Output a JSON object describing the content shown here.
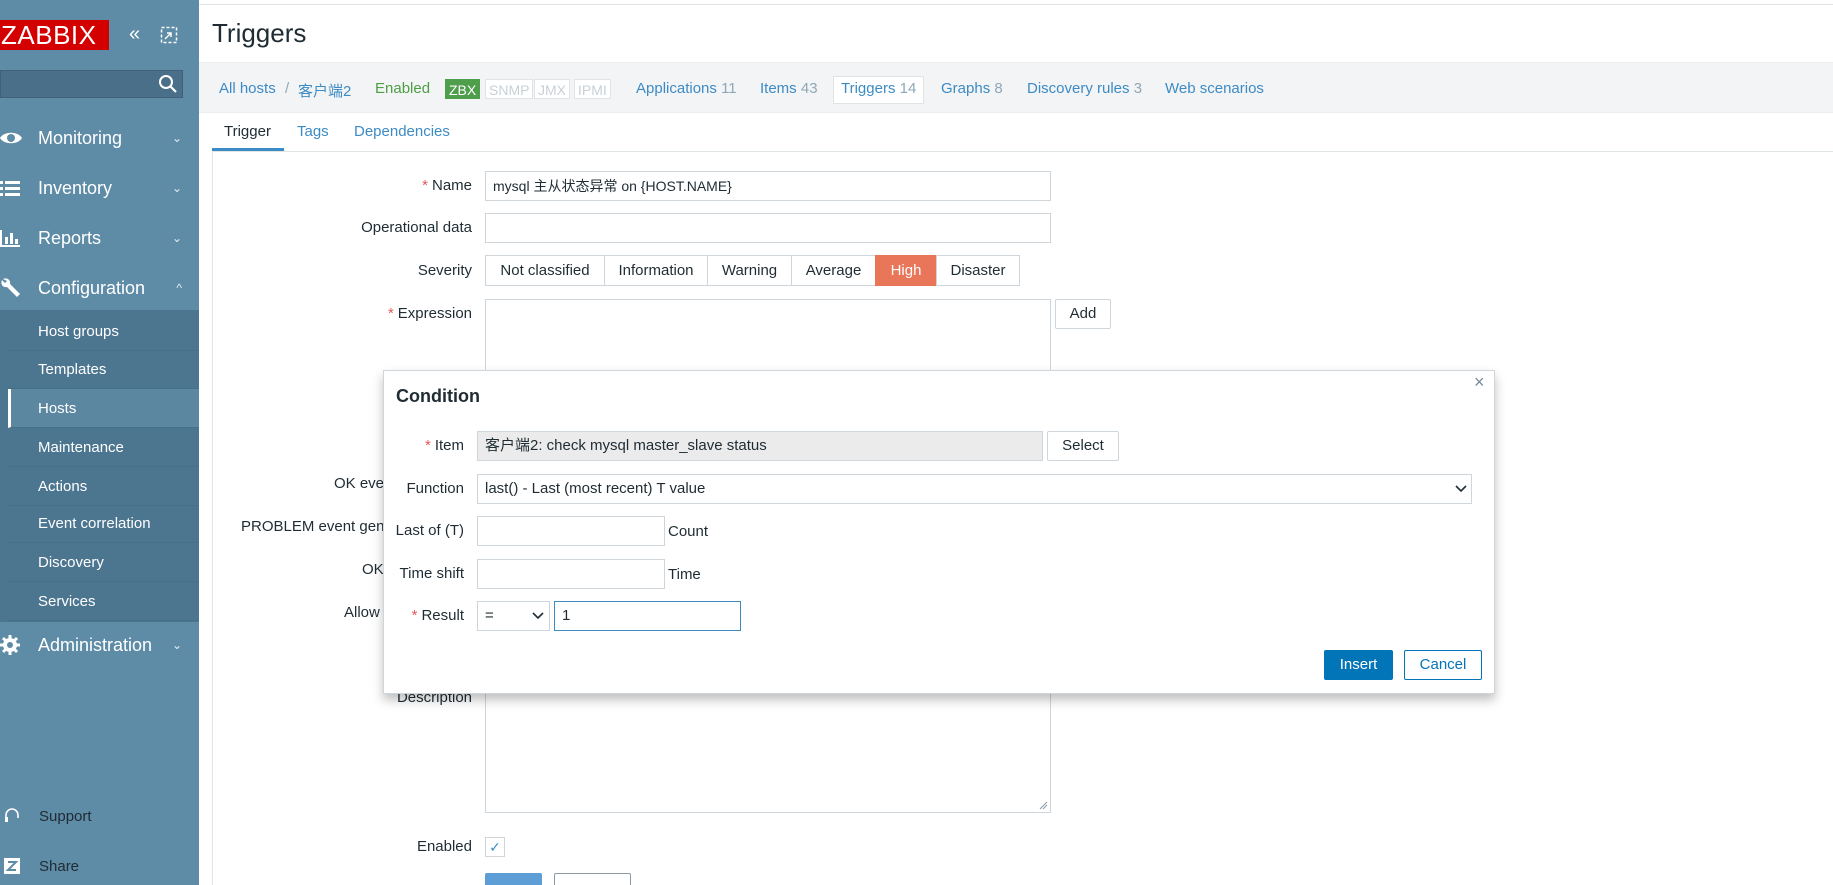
{
  "sidebar": {
    "logo": "ZABBIX",
    "collapse_glyph": "«",
    "kiosk_glyph": "⤢",
    "search": {
      "placeholder": "",
      "value": ""
    },
    "menu": [
      {
        "label": "Monitoring",
        "icon": "eye-icon",
        "expanded": false
      },
      {
        "label": "Inventory",
        "icon": "list-icon",
        "expanded": false
      },
      {
        "label": "Reports",
        "icon": "bar-chart-icon",
        "expanded": false
      },
      {
        "label": "Configuration",
        "icon": "wrench-icon",
        "expanded": true
      },
      {
        "label": "Administration",
        "icon": "gear-icon",
        "expanded": false
      }
    ],
    "chevron_down": "⌄",
    "chevron_up": "^",
    "config_submenu": [
      "Host groups",
      "Templates",
      "Hosts",
      "Maintenance",
      "Actions",
      "Event correlation",
      "Discovery",
      "Services"
    ],
    "active_submenu": "Hosts",
    "footer": [
      {
        "label": "Support",
        "icon": "headset-icon"
      },
      {
        "label": "Share",
        "icon": "share-z-icon"
      }
    ]
  },
  "page": {
    "title": "Triggers"
  },
  "hostbar": {
    "all_hosts": "All hosts",
    "separator": "/",
    "host": "客户端2",
    "status": "Enabled",
    "availability": [
      "ZBX",
      "SNMP",
      "JMX",
      "IPMI"
    ],
    "links": [
      {
        "label": "Applications",
        "count": "11"
      },
      {
        "label": "Items",
        "count": "43"
      },
      {
        "label": "Triggers",
        "count": "14"
      },
      {
        "label": "Graphs",
        "count": "8"
      },
      {
        "label": "Discovery rules",
        "count": "3"
      },
      {
        "label": "Web scenarios",
        "count": ""
      }
    ]
  },
  "form_tabs": [
    "Trigger",
    "Tags",
    "Dependencies"
  ],
  "form": {
    "name_label": "Name",
    "name_value": "mysql 主从状态异常 on {HOST.NAME}",
    "opdata_label": "Operational data",
    "opdata_value": "",
    "severity_label": "Severity",
    "severities": [
      "Not classified",
      "Information",
      "Warning",
      "Average",
      "High",
      "Disaster"
    ],
    "selected_severity": "High",
    "expression_label": "Expression",
    "add_button": "Add",
    "ok_event_label": "OK eve",
    "problem_event_label": "PROBLEM event gen",
    "ok_label": "OK",
    "allow_label": "Allow",
    "description_label": "Description",
    "enabled_label": "Enabled",
    "enabled_checked": true,
    "check_glyph": "✓"
  },
  "dialog": {
    "title": "Condition",
    "close_glyph": "×",
    "item_label": "Item",
    "item_value": "客户端2: check mysql master_slave status",
    "select_button": "Select",
    "function_label": "Function",
    "function_value": "last() - Last (most recent) T value",
    "last_of_label": "Last of (T)",
    "last_of_value": "",
    "last_of_unit": "Count",
    "time_shift_label": "Time shift",
    "time_shift_value": "",
    "time_shift_unit": "Time",
    "result_label": "Result",
    "result_operator": "=",
    "result_value": "1",
    "insert_button": "Insert",
    "cancel_button": "Cancel"
  },
  "colors": {
    "sidebar_bg": "#5e8ba6",
    "logo_red": "#d40000",
    "link_blue": "#3d8bc4",
    "high_severity": "#e97659",
    "primary_button": "#0275b8",
    "zbx_green": "#4f9e4c"
  }
}
